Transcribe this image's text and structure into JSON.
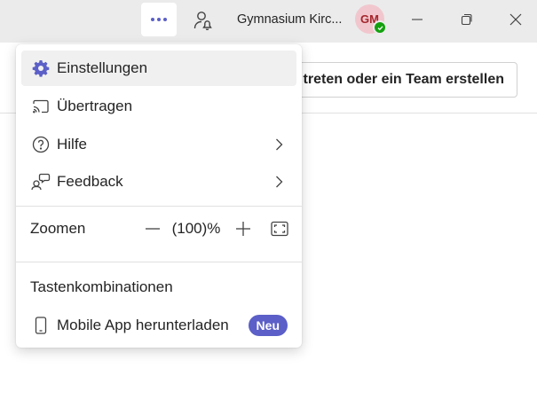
{
  "titlebar": {
    "more_label": "•••",
    "org_name": "Gymnasium Kirc...",
    "avatar_initials": "GM",
    "accent_color": "#5b5fc7"
  },
  "page": {
    "join_button": "treten oder ein Team erstellen"
  },
  "menu": {
    "items": [
      {
        "label": "Einstellungen",
        "icon": "gear-icon"
      },
      {
        "label": "Übertragen",
        "icon": "cast-icon"
      },
      {
        "label": "Hilfe",
        "icon": "help-icon"
      },
      {
        "label": "Feedback",
        "icon": "feedback-icon"
      }
    ],
    "zoom": {
      "label": "Zoomen",
      "value": "(100)%"
    },
    "shortcuts_label": "Tastenkombinationen",
    "mobile_app_label": "Mobile App herunterladen",
    "new_badge": "Neu"
  }
}
